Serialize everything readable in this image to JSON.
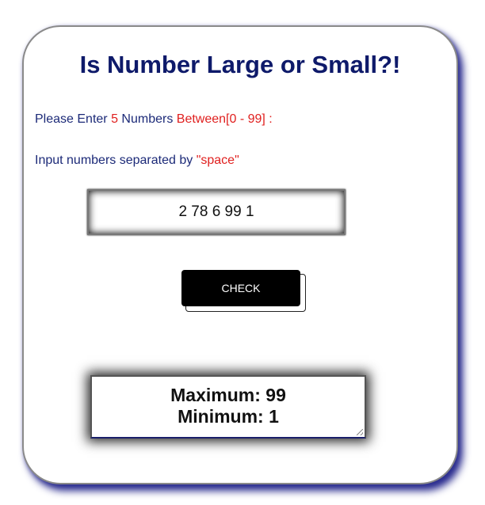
{
  "title": "Is Number Large or Small?!",
  "instruction": {
    "prefix": "Please Enter ",
    "count": "5",
    "middle": " Numbers ",
    "range": "Between[0 - 99] :"
  },
  "hint": {
    "prefix": "Input numbers separated by ",
    "separator": "\"space\""
  },
  "input": {
    "value": "2 78 6 99 1"
  },
  "button": {
    "label": "CHECK"
  },
  "result": {
    "maximum": "Maximum: 99",
    "minimum": "Minimum: 1"
  },
  "colors": {
    "title": "#0e1a6a",
    "text": "#1c2a78",
    "highlight": "#e0201f",
    "card_shadow": "#2b2d8f"
  }
}
